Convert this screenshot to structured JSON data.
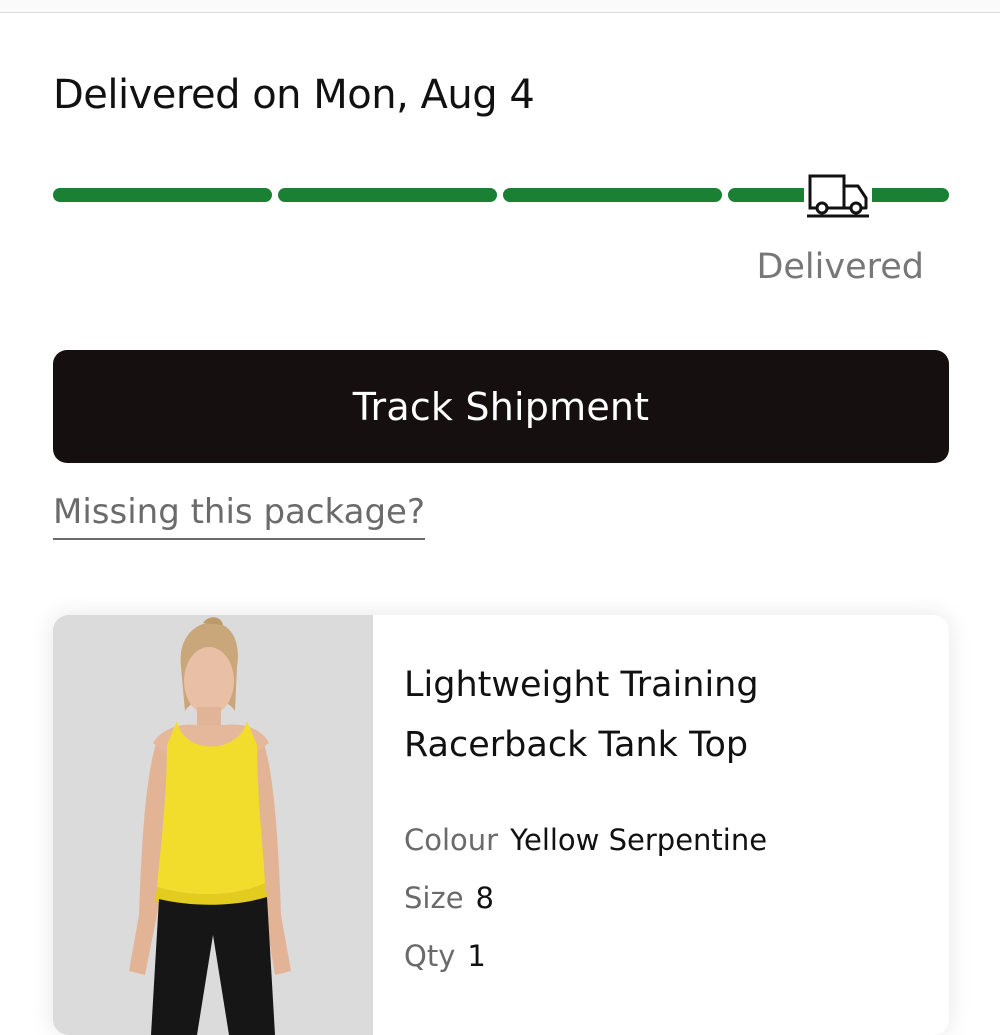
{
  "delivery": {
    "title": "Delivered on Mon, Aug 4",
    "status_label": "Delivered",
    "progress_steps_complete": 4,
    "progress_steps_total": 4,
    "progress_color": "#198034"
  },
  "actions": {
    "track_label": "Track Shipment",
    "missing_label": "Missing this package?"
  },
  "product": {
    "name_line1": "Lightweight Training",
    "name_line2": "Racerback Tank Top",
    "colour_label": "Colour",
    "colour_value": "Yellow Serpentine",
    "size_label": "Size",
    "size_value": "8",
    "qty_label": "Qty",
    "qty_value": "1",
    "image_icon": "product-photo"
  },
  "icons": {
    "truck": "delivery-truck-icon"
  }
}
